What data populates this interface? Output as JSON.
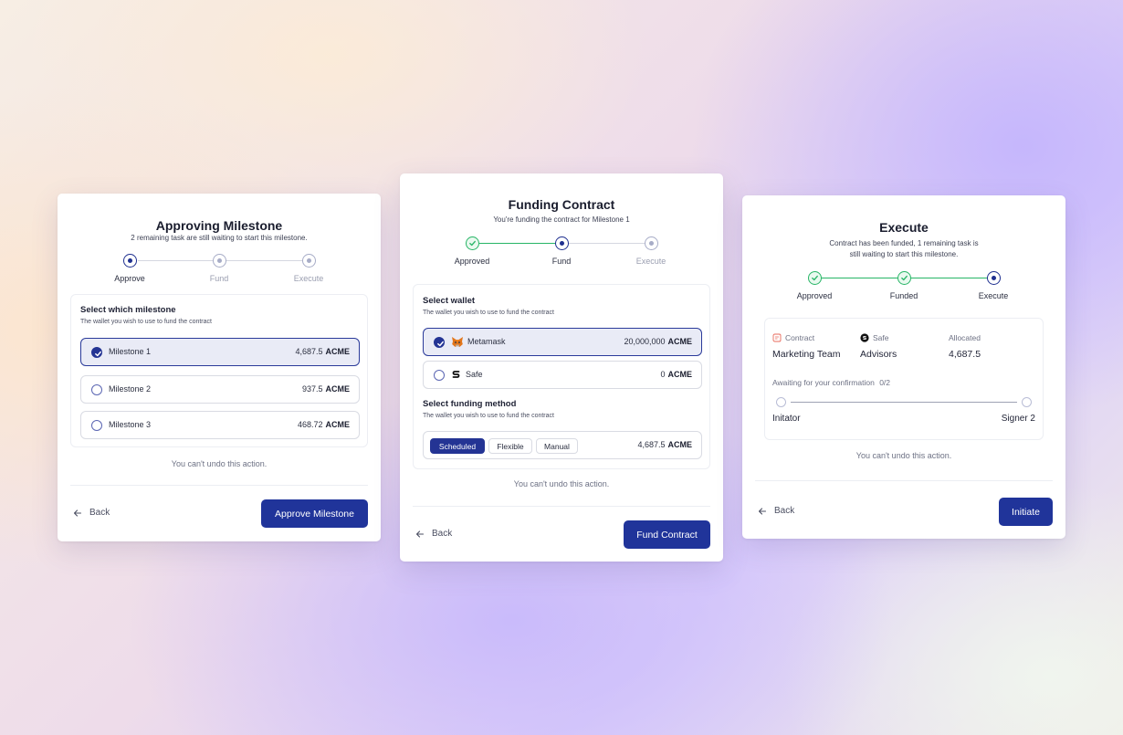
{
  "card1": {
    "title": "Approving Milestone",
    "subtitle": "2 remaining task are still waiting to start this milestone.",
    "steps": [
      "Approve",
      "Fund",
      "Execute"
    ],
    "panel_title": "Select which milestone",
    "panel_sub": "The wallet you wish to use to fund  the contract",
    "options": [
      {
        "label": "Milestone 1",
        "amount": "4,687.5",
        "unit": "ACME",
        "selected": true
      },
      {
        "label": "Milestone 2",
        "amount": "937.5",
        "unit": "ACME",
        "selected": false
      },
      {
        "label": "Milestone 3",
        "amount": "468.72",
        "unit": "ACME",
        "selected": false
      }
    ],
    "undo": "You can't undo this action.",
    "back": "Back",
    "action": "Approve Milestone"
  },
  "card2": {
    "title": "Funding Contract",
    "subtitle": "You're funding the contract for Milestone 1",
    "steps": [
      "Approved",
      "Fund",
      "Execute"
    ],
    "wallet_title": "Select wallet",
    "wallet_sub": "The wallet you wish to use to fund the contract",
    "wallets": [
      {
        "label": "Metamask",
        "icon": "metamask-fox-icon",
        "amount": "20,000,000",
        "unit": "ACME",
        "selected": true
      },
      {
        "label": "Safe",
        "icon": "safe-logo-icon",
        "amount": "0",
        "unit": "ACME",
        "selected": false
      }
    ],
    "method_title": "Select funding method",
    "method_sub": "The wallet you wish to use to fund  the contract",
    "methods": [
      "Scheduled",
      "Flexible",
      "Manual"
    ],
    "method_amount": "4,687.5",
    "method_unit": "ACME",
    "undo": "You can't undo this action.",
    "back": "Back",
    "action": "Fund Contract"
  },
  "card3": {
    "title": "Execute",
    "subtitle_line1": "Contract has been funded, 1 remaining task is",
    "subtitle_line2": "still waiting to start this milestone.",
    "steps": [
      "Approved",
      "Funded",
      "Execute"
    ],
    "info": [
      {
        "label": "Contract",
        "icon": "contract-icon",
        "value": "Marketing Team"
      },
      {
        "label": "Safe",
        "icon": "safe-icon",
        "value": "Advisors"
      },
      {
        "label": "Allocated",
        "value": "4,687.5"
      }
    ],
    "awaiting": "Awaiting for your confirmation",
    "awaiting_count": "0/2",
    "signers": [
      "Initator",
      "Signer 2"
    ],
    "undo": "You can't undo this action.",
    "back": "Back",
    "action": "Initiate"
  },
  "colors": {
    "primary": "#20349a",
    "success": "#27b566",
    "selected_bg": "#e9ebf6"
  }
}
